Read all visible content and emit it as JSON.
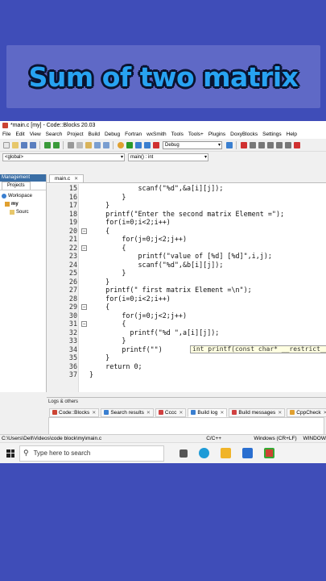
{
  "banner": {
    "title": "Sum of two matrix"
  },
  "window": {
    "title": "*main.c [my] - Code::Blocks 20.03"
  },
  "menu": [
    "File",
    "Edit",
    "View",
    "Search",
    "Project",
    "Build",
    "Debug",
    "Fortran",
    "wxSmith",
    "Tools",
    "Tools+",
    "Plugins",
    "DoxyBlocks",
    "Settings",
    "Help"
  ],
  "toolbar": {
    "build_target": "Debug"
  },
  "scope": {
    "global": "<global>",
    "function": "main() : int"
  },
  "management": {
    "header": "Management",
    "tab": "Projects",
    "tree": [
      "Workspace",
      "my",
      "Sourc"
    ]
  },
  "editor": {
    "file_tab": "main.c",
    "lines": [
      {
        "n": "15",
        "t": "            scanf(\"%d\",&a[i][j]);"
      },
      {
        "n": "16",
        "t": "        }"
      },
      {
        "n": "17",
        "t": "    }"
      },
      {
        "n": "18",
        "t": "    printf(\"Enter the second matrix Element =\");"
      },
      {
        "n": "19",
        "t": "    for(i=0;i<2;i++)"
      },
      {
        "n": "20",
        "t": "    {"
      },
      {
        "n": "21",
        "t": "        for(j=0;j<2;j++)"
      },
      {
        "n": "22",
        "t": "        {"
      },
      {
        "n": "23",
        "t": "            printf(\"value of [%d] [%d]\",i,j);"
      },
      {
        "n": "24",
        "t": "            scanf(\"%d\",&b[i][j]);"
      },
      {
        "n": "25",
        "t": "        }"
      },
      {
        "n": "26",
        "t": "    }"
      },
      {
        "n": "27",
        "t": "    printf(\" first matrix Element =\\n\");"
      },
      {
        "n": "28",
        "t": "    for(i=0;i<2;i++)"
      },
      {
        "n": "29",
        "t": "    {"
      },
      {
        "n": "30",
        "t": "        for(j=0;j<2;j++)"
      },
      {
        "n": "31",
        "t": "        {"
      },
      {
        "n": "32",
        "t": "          printf(\"%d \",a[i][j]);"
      },
      {
        "n": "33",
        "t": "        }"
      },
      {
        "n": "34",
        "t": "        printf(\"\")"
      },
      {
        "n": "35",
        "t": "    }"
      },
      {
        "n": "36",
        "t": "    return 0;"
      },
      {
        "n": "37",
        "t": "}"
      }
    ],
    "tooltip": "int printf(const char* __restrict__ _Form"
  },
  "logs": {
    "header": "Logs & others",
    "tabs": [
      "Code::Blocks",
      "Search results",
      "Cccc",
      "Build log",
      "Build messages",
      "CppCheck"
    ]
  },
  "status": {
    "path": "C:\\Users\\Dell\\Videos\\code block\\my\\main.c",
    "language": "C/C++",
    "eol": "Windows (CR+LF)",
    "encoding": "WINDOW"
  },
  "taskbar": {
    "search_placeholder": "Type here to search"
  }
}
